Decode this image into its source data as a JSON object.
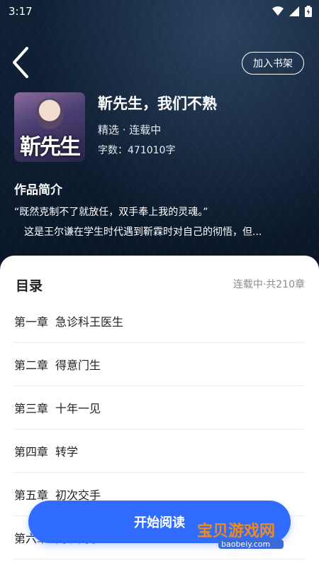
{
  "status": {
    "time": "3:17"
  },
  "header": {
    "shelf_button": "加入书架"
  },
  "book": {
    "cover_text": "靳先生",
    "title": "靳先生，我们不熟",
    "category_status": "精选 · 连载中",
    "word_count": "字数：471010字"
  },
  "intro": {
    "heading": "作品简介",
    "quote": "“既然克制不了就放任，双手奉上我的灵魂。”",
    "text": "这是王尔谦在学生时代遇到靳霖时对自己的彻悟，但..."
  },
  "toc": {
    "heading": "目录",
    "summary": "连载中·共210章",
    "chapters": [
      {
        "num": "第一章",
        "name": "急诊科王医生"
      },
      {
        "num": "第二章",
        "name": "得意门生"
      },
      {
        "num": "第三章",
        "name": "十年一见"
      },
      {
        "num": "第四章",
        "name": "转学"
      },
      {
        "num": "第五章",
        "name": "初次交手"
      },
      {
        "num": "第六章",
        "name": "同班同学"
      }
    ]
  },
  "actions": {
    "start_reading": "开始阅读"
  },
  "watermark": {
    "brand": "宝贝游戏网",
    "url": "baobeiy.com"
  },
  "colors": {
    "accent": "#2f6cff",
    "hero_bg": "#0e1d31"
  }
}
